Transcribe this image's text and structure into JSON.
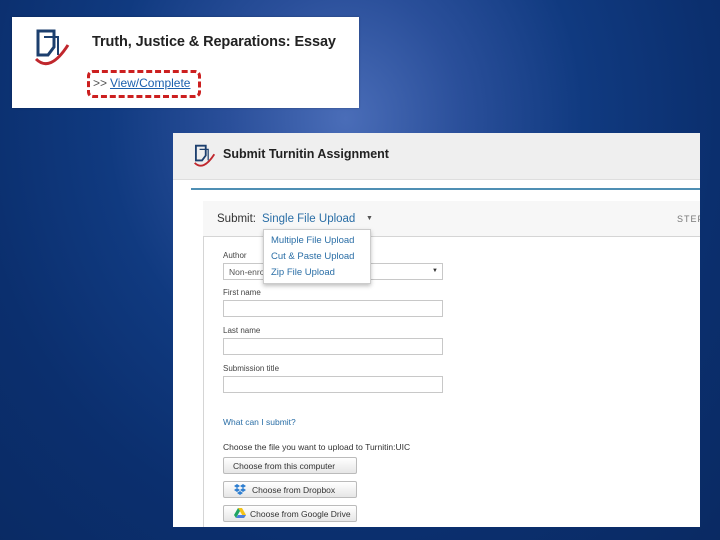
{
  "top_card": {
    "title": "Truth, Justice & Reparations: Essay",
    "link_prefix": ">>",
    "link_label": "View/Complete",
    "highlight_color": "#cc1f1f"
  },
  "panel": {
    "header_title": "Submit Turnitin Assignment",
    "submit_label": "Submit:",
    "submit_type": "Single File Upload",
    "step_indicator": "STEP",
    "dropdown_options": [
      "Multiple File Upload",
      "Cut & Paste Upload",
      "Zip File Upload"
    ],
    "form": {
      "author_label": "Author",
      "author_value": "Non-enro",
      "first_name_label": "First name",
      "first_name_value": "",
      "last_name_label": "Last name",
      "last_name_value": "",
      "submission_title_label": "Submission title",
      "submission_title_value": ""
    },
    "help_link": "What can I submit?",
    "choose_label": "Choose the file you want to upload to Turnitin:UIC",
    "buttons": {
      "computer": "Choose from this computer",
      "dropbox": "Choose from Dropbox",
      "google_drive": "Choose from Google Drive"
    },
    "accent_color": "#4f8fb4",
    "link_color": "#2a6ea6"
  },
  "icons": {
    "turnitin_logo": "turnitin-logo-icon",
    "dropbox": "dropbox-icon",
    "google_drive": "google-drive-icon"
  }
}
